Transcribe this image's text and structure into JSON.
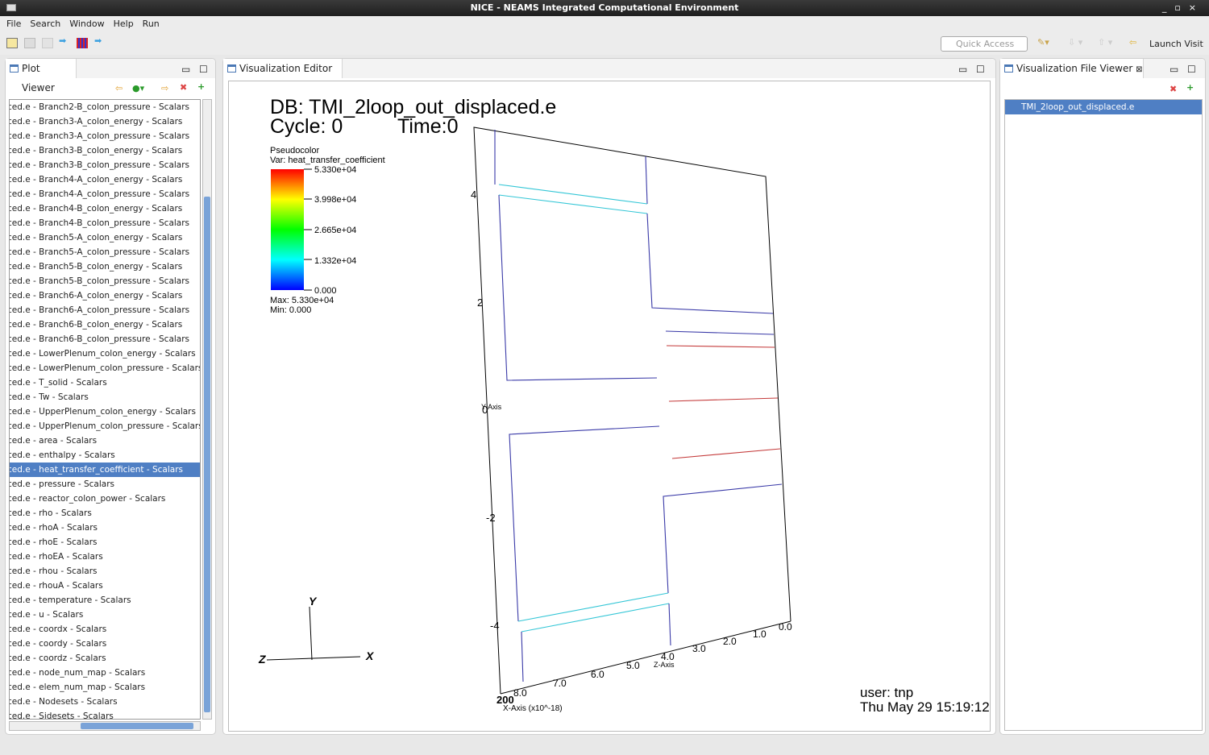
{
  "window": {
    "title": "NICE - NEAMS Integrated Computational Environment"
  },
  "menu": [
    "File",
    "Search",
    "Window",
    "Help",
    "Run"
  ],
  "toolbar": {
    "quick_access_placeholder": "Quick Access",
    "launch_visit": "Launch Visit"
  },
  "plot_viewer": {
    "title": "Plot Viewer",
    "selected_index": 25,
    "items": [
      "ced.e - Branch2-B_colon_pressure - Scalars",
      "ced.e - Branch3-A_colon_energy - Scalars",
      "ced.e - Branch3-A_colon_pressure - Scalars",
      "ced.e - Branch3-B_colon_energy - Scalars",
      "ced.e - Branch3-B_colon_pressure - Scalars",
      "ced.e - Branch4-A_colon_energy - Scalars",
      "ced.e - Branch4-A_colon_pressure - Scalars",
      "ced.e - Branch4-B_colon_energy - Scalars",
      "ced.e - Branch4-B_colon_pressure - Scalars",
      "ced.e - Branch5-A_colon_energy - Scalars",
      "ced.e - Branch5-A_colon_pressure - Scalars",
      "ced.e - Branch5-B_colon_energy - Scalars",
      "ced.e - Branch5-B_colon_pressure - Scalars",
      "ced.e - Branch6-A_colon_energy - Scalars",
      "ced.e - Branch6-A_colon_pressure - Scalars",
      "ced.e - Branch6-B_colon_energy - Scalars",
      "ced.e - Branch6-B_colon_pressure - Scalars",
      "ced.e - LowerPlenum_colon_energy - Scalars",
      "ced.e - LowerPlenum_colon_pressure - Scalars",
      "ced.e - T_solid - Scalars",
      "ced.e - Tw - Scalars",
      "ced.e - UpperPlenum_colon_energy - Scalars",
      "ced.e - UpperPlenum_colon_pressure - Scalars",
      "ced.e - area - Scalars",
      "ced.e - enthalpy - Scalars",
      "ced.e - heat_transfer_coefficient - Scalars",
      "ced.e - pressure - Scalars",
      "ced.e - reactor_colon_power - Scalars",
      "ced.e - rho - Scalars",
      "ced.e - rhoA - Scalars",
      "ced.e - rhoE - Scalars",
      "ced.e - rhoEA - Scalars",
      "ced.e - rhou - Scalars",
      "ced.e - rhouA - Scalars",
      "ced.e - temperature - Scalars",
      "ced.e - u - Scalars",
      "ced.e - coordx - Scalars",
      "ced.e - coordy - Scalars",
      "ced.e - coordz - Scalars",
      "ced.e - node_num_map - Scalars",
      "ced.e - elem_num_map - Scalars",
      "ced.e - Nodesets - Scalars",
      "ced.e - Sidesets - Scalars"
    ]
  },
  "editor": {
    "title": "Visualization Editor",
    "db": "DB: TMI_2loop_out_displaced.e",
    "cycle": "Cycle: 0",
    "time": "Time:0",
    "legend": {
      "plot": "Pseudocolor",
      "var": "Var: heat_transfer_coefficient",
      "ticks": [
        "5.330e+04",
        "3.998e+04",
        "2.665e+04",
        "1.332e+04",
        "0.000"
      ],
      "max": "Max:  5.330e+04",
      "min": "Min:  0.000"
    },
    "y_ticks": [
      "4",
      "2",
      "0",
      "-2",
      "-4"
    ],
    "y_label": "Y-Axis",
    "z_ticks": [
      "0.0",
      "1.0",
      "2.0",
      "3.0",
      "4.0",
      "5.0",
      "6.0",
      "7.0",
      "8.0"
    ],
    "z_label": "Z-Axis",
    "x_label": "X-Axis (x10^-18)",
    "x_tick": "200",
    "triad": {
      "x": "X",
      "y": "Y",
      "z": "Z"
    },
    "user": "user: tnp",
    "date": "Thu May 29 15:19:12"
  },
  "file_viewer": {
    "title": "Visualization File Viewer",
    "files": [
      "TMI_2loop_out_displaced.e"
    ]
  },
  "colors": {
    "selection": "#4f7fc4",
    "blue_line": "#3a3aa8",
    "cyan_line": "#33c6d6",
    "red_line": "#c43a3a"
  }
}
